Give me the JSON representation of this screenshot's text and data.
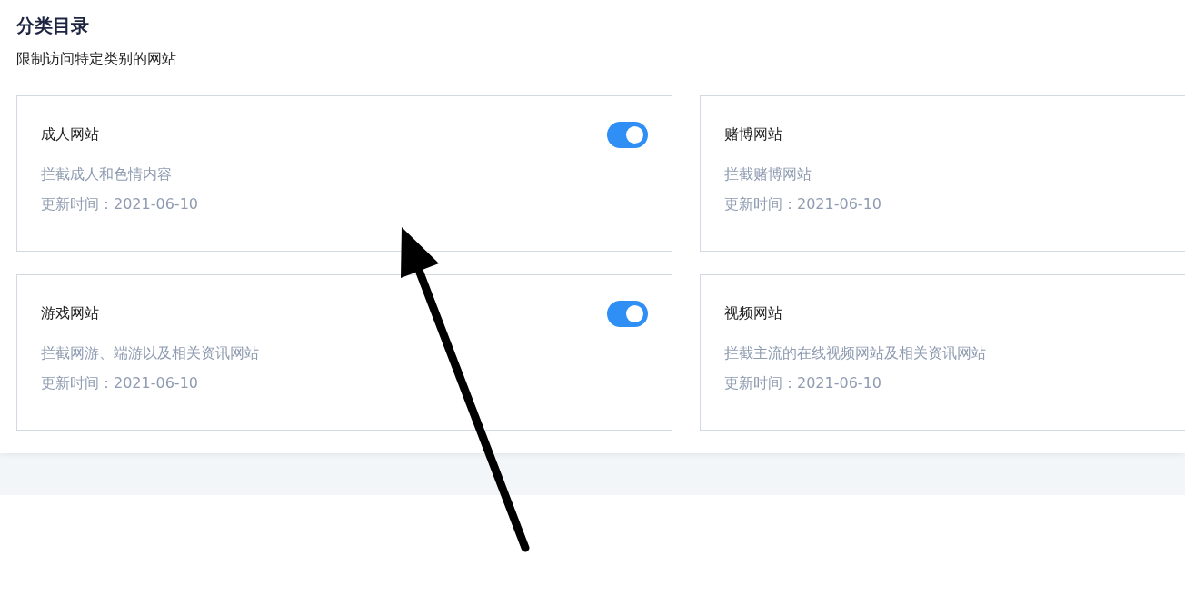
{
  "section": {
    "title": "分类目录",
    "subtitle": "限制访问特定类别的网站"
  },
  "cards": [
    {
      "name": "成人网站",
      "description": "拦截成人和色情内容",
      "updated": "更新时间：2021-06-10",
      "toggle": {
        "on": true
      }
    },
    {
      "name": "赌博网站",
      "description": "拦截赌博网站",
      "updated": "更新时间：2021-06-10"
    },
    {
      "name": "游戏网站",
      "description": "拦截网游、端游以及相关资讯网站",
      "updated": "更新时间：2021-06-10",
      "toggle": {
        "on": true
      }
    },
    {
      "name": "视频网站",
      "description": "拦截主流的在线视频网站及相关资讯网站",
      "updated": "更新时间：2021-06-10"
    }
  ]
}
